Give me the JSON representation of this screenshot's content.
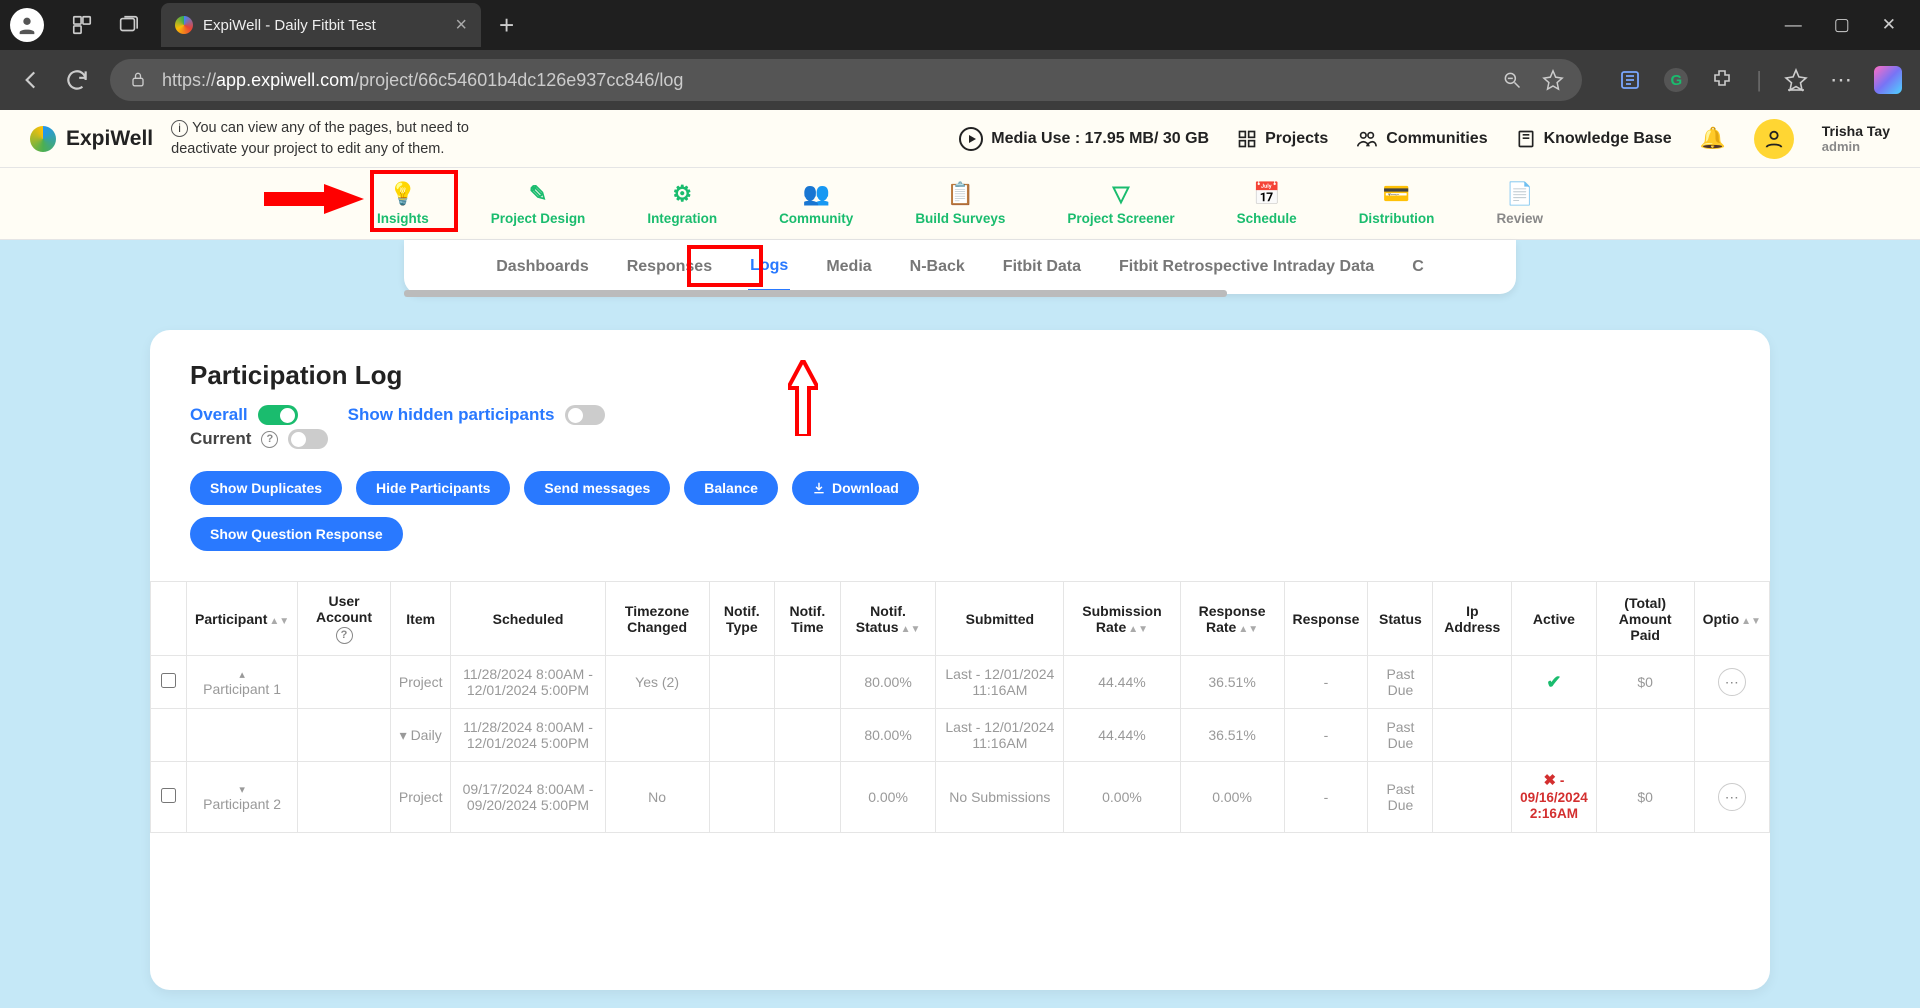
{
  "browser": {
    "tab_title": "ExpiWell - Daily Fitbit Test",
    "url_prefix": "https://",
    "url_host": "app.expiwell.com",
    "url_path": "/project/66c54601b4dc126e937cc846/log"
  },
  "header": {
    "logo": "ExpiWell",
    "info_note": "You can view any of the pages, but need to deactivate your project to edit any of them.",
    "media_use": "Media Use : 17.95 MB/ 30 GB",
    "projects": "Projects",
    "communities": "Communities",
    "knowledge_base": "Knowledge Base",
    "user_name": "Trisha Tay",
    "user_role": "admin"
  },
  "project_tabs": [
    "Insights",
    "Project Design",
    "Integration",
    "Community",
    "Build Surveys",
    "Project Screener",
    "Schedule",
    "Distribution",
    "Review"
  ],
  "sub_tabs": [
    "Dashboards",
    "Responses",
    "Logs",
    "Media",
    "N-Back",
    "Fitbit Data",
    "Fitbit Retrospective Intraday Data",
    "C"
  ],
  "card": {
    "title": "Participation Log",
    "overall": "Overall",
    "current": "Current",
    "show_hidden": "Show hidden participants",
    "buttons": [
      "Show Duplicates",
      "Hide Participants",
      "Send messages",
      "Balance",
      "Download",
      "Show Question Response"
    ]
  },
  "table": {
    "headers": [
      "",
      "Participant",
      "User Account",
      "Item",
      "Scheduled",
      "Timezone Changed",
      "Notif. Type",
      "Notif. Time",
      "Notif. Status",
      "Submitted",
      "Submission Rate",
      "Response Rate",
      "Response",
      "Status",
      "Ip Address",
      "Active",
      "(Total) Amount Paid",
      "Optio"
    ],
    "rows": [
      {
        "checkbox": true,
        "chev": "▴",
        "participant": "Participant 1",
        "user": "",
        "item": "Project",
        "scheduled": "11/28/2024 8:00AM - 12/01/2024 5:00PM",
        "tz": "Yes (2)",
        "ntype": "",
        "ntime": "",
        "nstatus": "80.00%",
        "submitted": "Last - 12/01/2024 11:16AM",
        "srate": "44.44%",
        "rrate": "36.51%",
        "resp": "-",
        "status": "Past Due",
        "ip": "",
        "active": "check",
        "paid": "$0",
        "opt": true
      },
      {
        "checkbox": false,
        "chev": "",
        "participant": "",
        "user": "",
        "item": "▾ Daily",
        "scheduled": "11/28/2024 8:00AM - 12/01/2024 5:00PM",
        "tz": "",
        "ntype": "",
        "ntime": "",
        "nstatus": "80.00%",
        "submitted": "Last - 12/01/2024 11:16AM",
        "srate": "44.44%",
        "rrate": "36.51%",
        "resp": "-",
        "status": "Past Due",
        "ip": "",
        "active": "",
        "paid": "",
        "opt": false
      },
      {
        "checkbox": true,
        "chev": "▾",
        "participant": "Participant 2",
        "user": "",
        "item": "Project",
        "scheduled": "09/17/2024 8:00AM - 09/20/2024 5:00PM",
        "tz": "No",
        "ntype": "",
        "ntime": "",
        "nstatus": "0.00%",
        "submitted": "No Submissions",
        "srate": "0.00%",
        "rrate": "0.00%",
        "resp": "-",
        "status": "Past Due",
        "ip": "",
        "active": "red",
        "active_text": "✖ - 09/16/2024 2:16AM",
        "paid": "$0",
        "opt": true
      }
    ]
  }
}
